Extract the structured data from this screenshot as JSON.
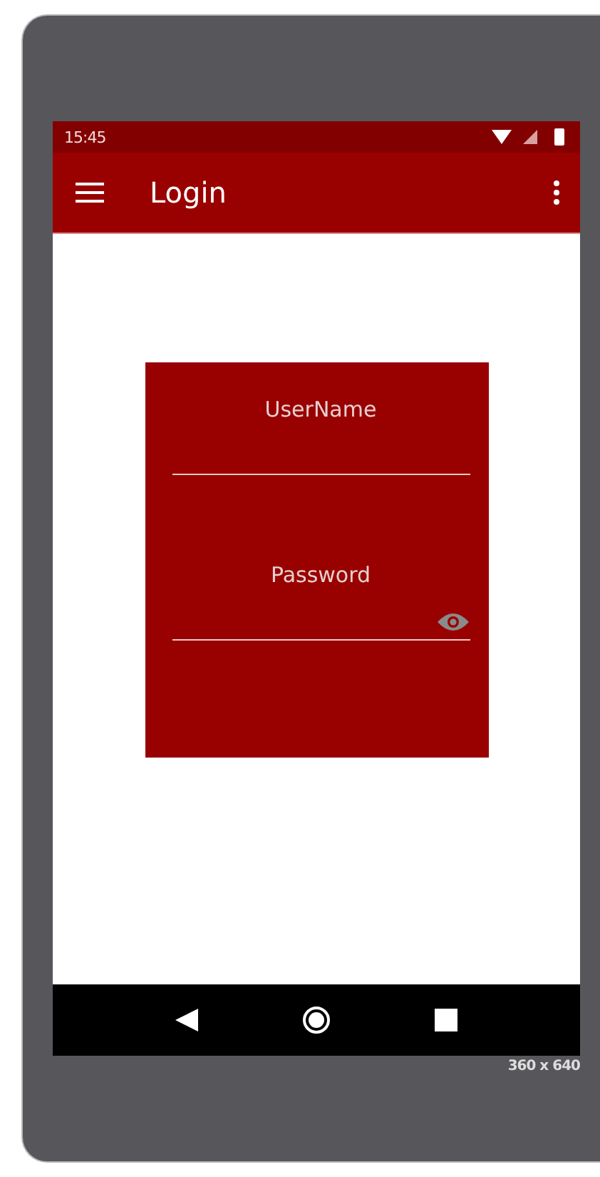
{
  "status_bar": {
    "time": "15:45"
  },
  "app_bar": {
    "title": "Login"
  },
  "login_form": {
    "fields": [
      {
        "kind": "text",
        "placeholder": "UserName"
      },
      {
        "kind": "password",
        "placeholder": "Password"
      }
    ]
  },
  "device_size": "360 x 640"
}
